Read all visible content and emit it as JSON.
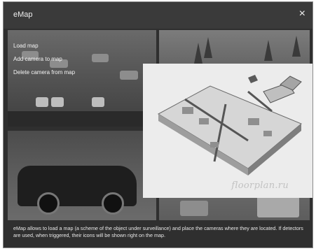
{
  "window": {
    "title": "eMap",
    "close_icon": "×"
  },
  "menu": {
    "items": [
      {
        "label": "Load map"
      },
      {
        "label": "Add camera to map"
      },
      {
        "label": "Delete camera from map"
      }
    ]
  },
  "map": {
    "watermark": "floorplan.ru"
  },
  "description": "eMap allows to load a map (a scheme of the object under surveillance) and place the cameras where they are located. If detectors are used, when triggered, their icons will be shown right on the map.",
  "colors": {
    "window_bg": "#2f2f2f",
    "map_panel_bg": "#ececec"
  }
}
